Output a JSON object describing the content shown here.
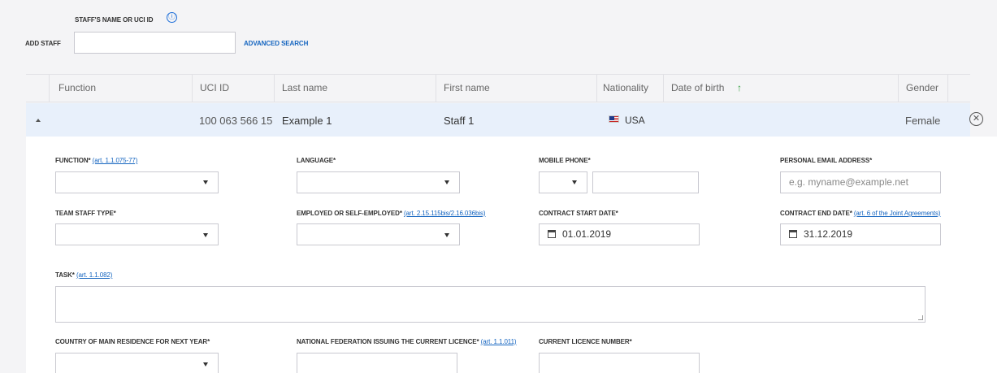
{
  "search": {
    "label": "STAFF'S NAME OR UCI ID",
    "info_icon": "ⓘ",
    "add_staff_label": "ADD STAFF",
    "input_value": "",
    "advanced_search": "ADVANCED SEARCH"
  },
  "table": {
    "headers": [
      "Function",
      "UCI ID",
      "Last name",
      "First name",
      "Nationality",
      "Date of birth",
      "Gender"
    ],
    "sort_indicator": "↑",
    "row": {
      "function": "",
      "uci_id": "100 063 566 15",
      "last_name": "Example 1",
      "first_name": "Staff 1",
      "nationality": "USA",
      "gender": "Female",
      "close_icon": "✕"
    }
  },
  "form": {
    "function": {
      "label": "FUNCTION*",
      "link": "(art. 1.1.075-77)"
    },
    "language": {
      "label": "LANGUAGE*"
    },
    "mobile_phone": {
      "label": "MOBILE PHONE*"
    },
    "email": {
      "label": "PERSONAL EMAIL ADDRESS*",
      "placeholder": "e.g. myname@example.net"
    },
    "team_staff_type": {
      "label": "TEAM STAFF TYPE*"
    },
    "employed": {
      "label": "EMPLOYED OR SELF-EMPLOYED*",
      "link": "(art. 2.15.115bis/2.16.036bis)"
    },
    "contract_start": {
      "label": "CONTRACT START DATE*",
      "value": "01.01.2019"
    },
    "contract_end": {
      "label": "CONTRACT END DATE*",
      "link": "(art. 6 of the Joint Agreements)",
      "value": "31.12.2019"
    },
    "task": {
      "label": "TASK*",
      "link": "(art. 1.1.082)"
    },
    "country": {
      "label": "COUNTRY OF MAIN RESIDENCE FOR NEXT YEAR*"
    },
    "federation": {
      "label": "NATIONAL FEDERATION ISSUING THE CURRENT LICENCE*",
      "link": "(art. 1.1.011)"
    },
    "licence_number": {
      "label": "CURRENT LICENCE NUMBER*"
    }
  },
  "colors": {
    "accent": "#1565c0",
    "row_highlight": "#e8f0fb",
    "sort_arrow": "#2e9d3a"
  },
  "icons": {
    "calendar": "calendar-icon",
    "dropdown": "chevron-down-icon",
    "info": "info-icon",
    "close": "close-icon"
  }
}
